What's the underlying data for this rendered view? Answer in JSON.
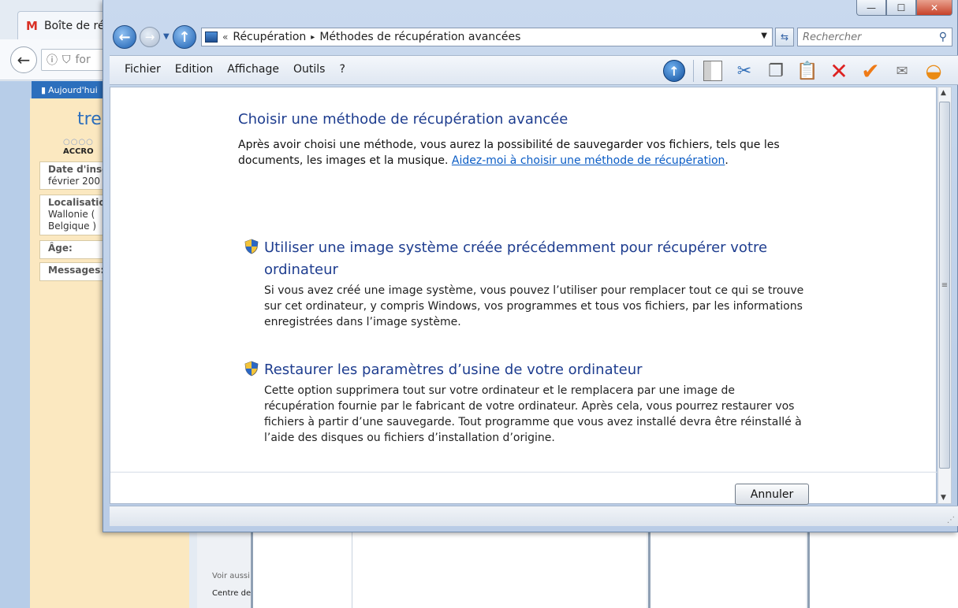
{
  "background_browser": {
    "tab_title": "Boîte de ré",
    "url_partial": "for",
    "sidebar_tab": "Aujourd'hui",
    "username_partial": "tre",
    "rank_dots": "○○○○",
    "rank": "ACCRO",
    "fields": {
      "date_label": "Date d'insc",
      "date_value": "février 200",
      "location_label": "Localisatio",
      "location_value_1": "Wallonie (",
      "location_value_2": "Belgique )",
      "age_label": "Âge:",
      "messages_label": "Messages:"
    },
    "see_also": "Voir aussi",
    "center": "Centre de"
  },
  "window": {
    "controls": {
      "minimize": "—",
      "maximize": "☐",
      "close": "✕"
    },
    "address": {
      "chevron": "«",
      "segments": [
        "Récupération",
        "▸",
        "Méthodes de récupération avancées"
      ]
    },
    "search": {
      "placeholder": "Rechercher"
    },
    "menu": [
      "Fichier",
      "Edition",
      "Affichage",
      "Outils",
      "?"
    ],
    "toolbar_icons": [
      "up-folder-icon",
      "panel-icon",
      "cut-icon",
      "copy-icon",
      "paste-icon",
      "delete-icon",
      "check-icon",
      "mail-icon",
      "shell-icon"
    ]
  },
  "content": {
    "heading": "Choisir une méthode de récupération avancée",
    "intro_text": "Après avoir choisi une méthode, vous aurez la possibilité de sauvegarder vos fichiers, tels que les documents, les images et la musique. ",
    "help_link": "Aidez-moi à choisir une méthode de récupération",
    "intro_end": ".",
    "options": [
      {
        "title": "Utiliser une image système créée précédemment pour récupérer votre ordinateur",
        "description": "Si vous avez créé une image système, vous pouvez l’utiliser pour remplacer tout ce qui se trouve sur cet ordinateur, y compris Windows, vos programmes et tous vos fichiers, par les informations enregistrées dans l’image système."
      },
      {
        "title": "Restaurer les paramètres d’usine de votre ordinateur",
        "description": "Cette option supprimera tout sur votre ordinateur et le remplacera par une image de récupération fournie par le fabricant de votre ordinateur. Après cela, vous pourrez restaurer vos fichiers à partir d’une sauvegarde. Tout programme que vous avez installé devra être réinstallé à l’aide des disques ou fichiers d’installation d’origine."
      }
    ],
    "cancel_label": "Annuler"
  }
}
